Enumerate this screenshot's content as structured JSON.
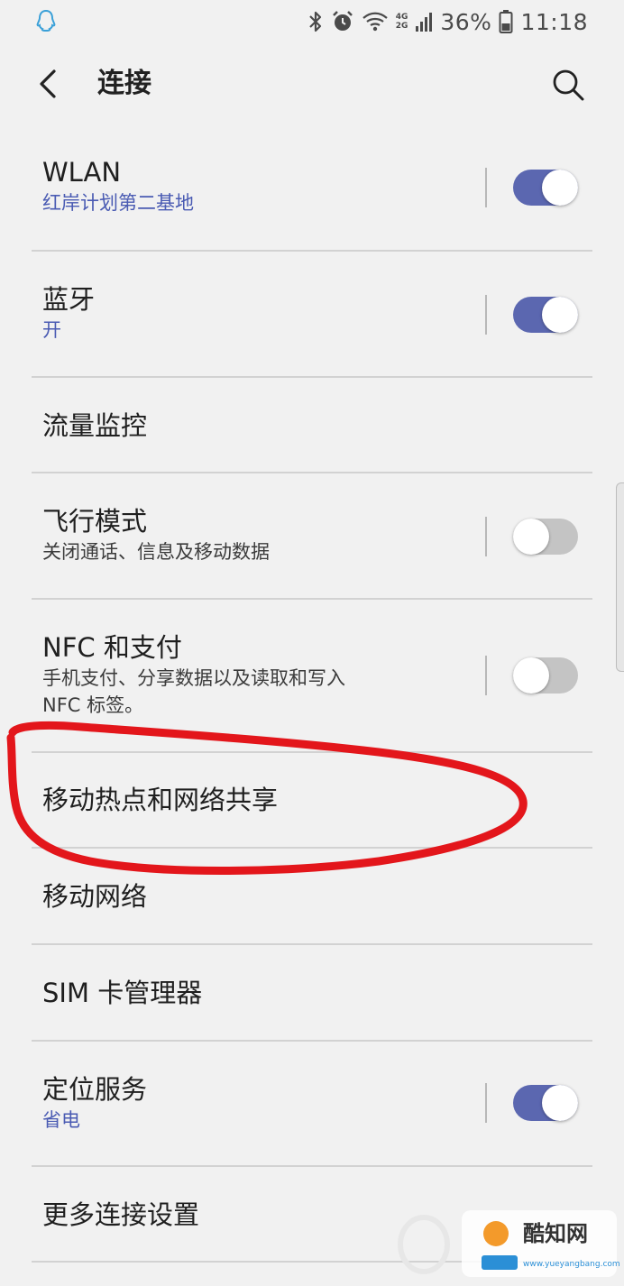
{
  "status_bar": {
    "battery_percent": "36%",
    "time": "11:18",
    "net_top": "4G",
    "net_bottom": "2G",
    "icons": [
      "qq-icon",
      "bluetooth-icon",
      "alarm-icon",
      "wifi-icon",
      "signal-icon",
      "battery-icon"
    ]
  },
  "app_bar": {
    "title": "连接",
    "back_icon": "chevron-left-icon",
    "search_icon": "search-icon"
  },
  "colors": {
    "accent": "#5b67b0",
    "subtitle_accent": "#4a5bb3",
    "background": "#f1f1f1",
    "annotation_red": "#e3161b"
  },
  "settings": [
    {
      "title": "WLAN",
      "subtitle": "红岸计划第二基地",
      "toggle": true
    },
    {
      "title": "蓝牙",
      "subtitle": "开",
      "toggle": true
    },
    {
      "title": "流量监控"
    },
    {
      "title": "飞行模式",
      "subtitle": "关闭通话、信息及移动数据",
      "toggle": false
    },
    {
      "title": "NFC 和支付",
      "subtitle": "手机支付、分享数据以及读取和写入 NFC 标签。",
      "toggle": false
    },
    {
      "title": "移动热点和网络共享"
    },
    {
      "title": "移动网络"
    },
    {
      "title": "SIM 卡管理器"
    },
    {
      "title": "定位服务",
      "subtitle": "省电",
      "toggle": true
    },
    {
      "title": "更多连接设置"
    }
  ],
  "watermark": {
    "text": "酷知网",
    "url": "www.yueyangbang.com"
  }
}
